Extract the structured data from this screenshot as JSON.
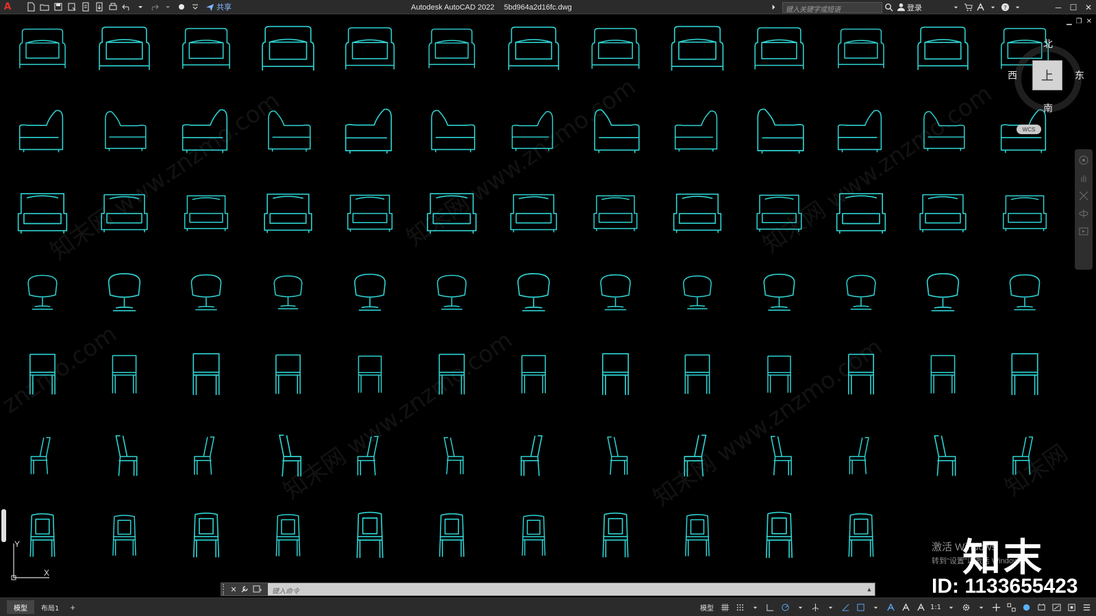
{
  "window": {
    "app_title": "Autodesk AutoCAD 2022",
    "file_name": "5bd964a2d16fc.dwg"
  },
  "toolbar": {
    "share_label": "共享",
    "search_placeholder": "键入关键字或短语",
    "login_label": "登录"
  },
  "viewcube": {
    "north": "北",
    "south": "南",
    "east": "东",
    "west": "西",
    "top_face": "上",
    "wcs_label": "WCS"
  },
  "ucs": {
    "x_label": "X",
    "y_label": "Y"
  },
  "watermarks": [
    "知末网 www.znzmo.com",
    "知末网 www.znzmo.com",
    "知末网 www.znzmo.com",
    "知末网 www.znzmo.com",
    "知末网 www.znzmo.com",
    "znzmo.com",
    "知末网"
  ],
  "activation": {
    "line1": "激活 Windows",
    "line2": "转到\"设置\"以激活 Windows。"
  },
  "brand": {
    "logo_text": "知末",
    "id_text": "ID: 1133655423"
  },
  "command_line": {
    "placeholder": "键入命令"
  },
  "status_bar": {
    "tabs": [
      "模型",
      "布局1"
    ],
    "add_tab": "+",
    "model_label": "模型",
    "scale_label": "1:1"
  },
  "colors": {
    "drawing_stroke": "#2fd3d3",
    "background": "#000000",
    "titlebar": "#2b2b2b"
  },
  "drawing": {
    "rows": 7,
    "columns": 13,
    "row_types": [
      "armchair",
      "armchair-side",
      "sofa-chair",
      "swivel-chair",
      "dining-chair",
      "side-chair",
      "high-back-chair"
    ]
  }
}
